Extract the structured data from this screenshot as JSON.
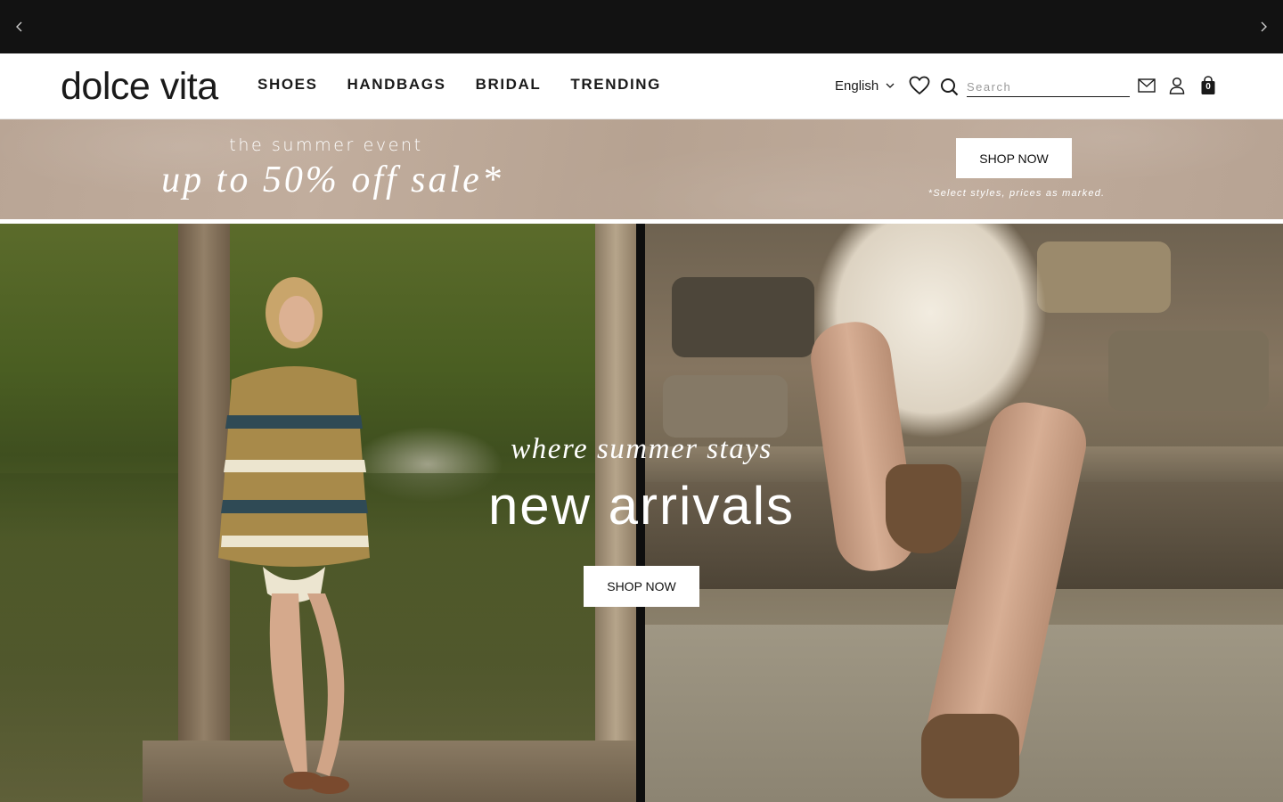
{
  "announcement": {
    "prev_icon": "chevron-left-icon",
    "next_icon": "chevron-right-icon",
    "bg_color": "#121212"
  },
  "header": {
    "logo": "dolce vita",
    "nav": [
      "SHOES",
      "HANDBAGS",
      "BRIDAL",
      "TRENDING"
    ],
    "language": "English",
    "search_placeholder": "Search",
    "cart_count": "0",
    "icons": [
      "heart-icon",
      "search-icon",
      "mail-icon",
      "user-icon",
      "bag-icon"
    ]
  },
  "promo": {
    "event": "the summer event",
    "sale": "up to 50% off sale*",
    "button": "SHOP NOW",
    "note": "*Select styles, prices as marked."
  },
  "hero": {
    "subtitle": "where summer stays",
    "title": "new arrivals",
    "button": "SHOP NOW"
  }
}
